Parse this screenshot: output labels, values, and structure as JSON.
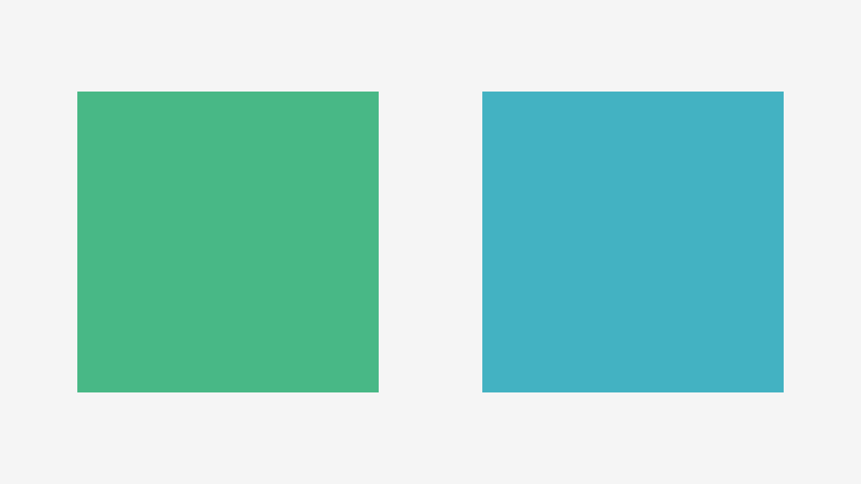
{
  "colors": {
    "background": "#f5f5f5",
    "swatches": [
      "#48b886",
      "#43b2c2"
    ]
  }
}
